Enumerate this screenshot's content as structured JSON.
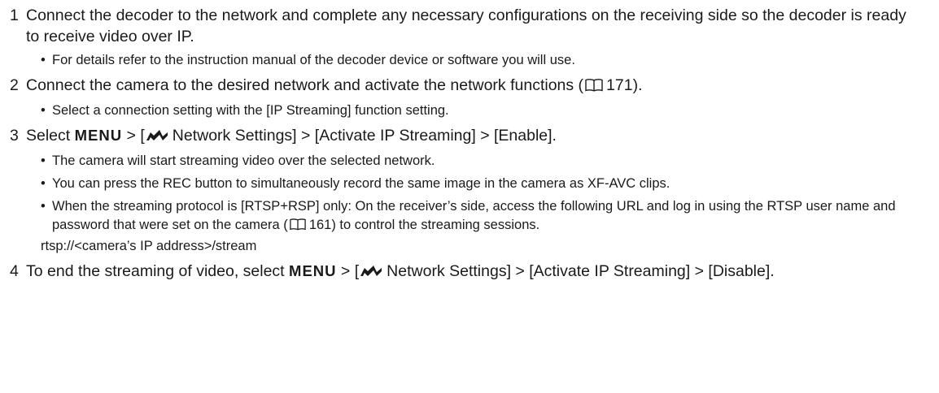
{
  "steps": [
    {
      "number": "1",
      "text": "Connect the decoder to the network and complete any necessary configurations on the receiving side so the decoder is ready to receive video over IP.",
      "bullets": [
        "For details refer to the instruction manual of the decoder device or software you will use."
      ]
    },
    {
      "number": "2",
      "text_before": "Connect the camera to the desired network and activate the network functions (",
      "page_ref": "171",
      "text_after": ").",
      "bullets": [
        "Select a connection setting with the [IP Streaming] function setting."
      ]
    },
    {
      "number": "3",
      "text_before": "Select",
      "menu": "MENU",
      "text_mid": " > [",
      "text_after": "Network Settings] > [Activate IP Streaming] > [Enable].",
      "bullets": [
        "The camera will start streaming video over the selected network.",
        "You can press the REC button to simultaneously record the same image in the camera as XF-AVC clips."
      ],
      "bullet3_before": "When the streaming protocol is [RTSP+RSP] only: On the receiver’s side, access the following URL and log in using the RTSP user name and password that were set on the camera (",
      "bullet3_ref": "161",
      "bullet3_after": ") to control the streaming sessions.",
      "url": "rtsp://<camera’s IP address>/stream"
    },
    {
      "number": "4",
      "text_before": "To end the streaming of video, select",
      "menu": "MENU",
      "text_mid": " > [",
      "text_after": "Network Settings] > [Activate IP Streaming] > [Disable]."
    }
  ],
  "icons": {
    "book": "book-icon",
    "network": "network-icon"
  }
}
